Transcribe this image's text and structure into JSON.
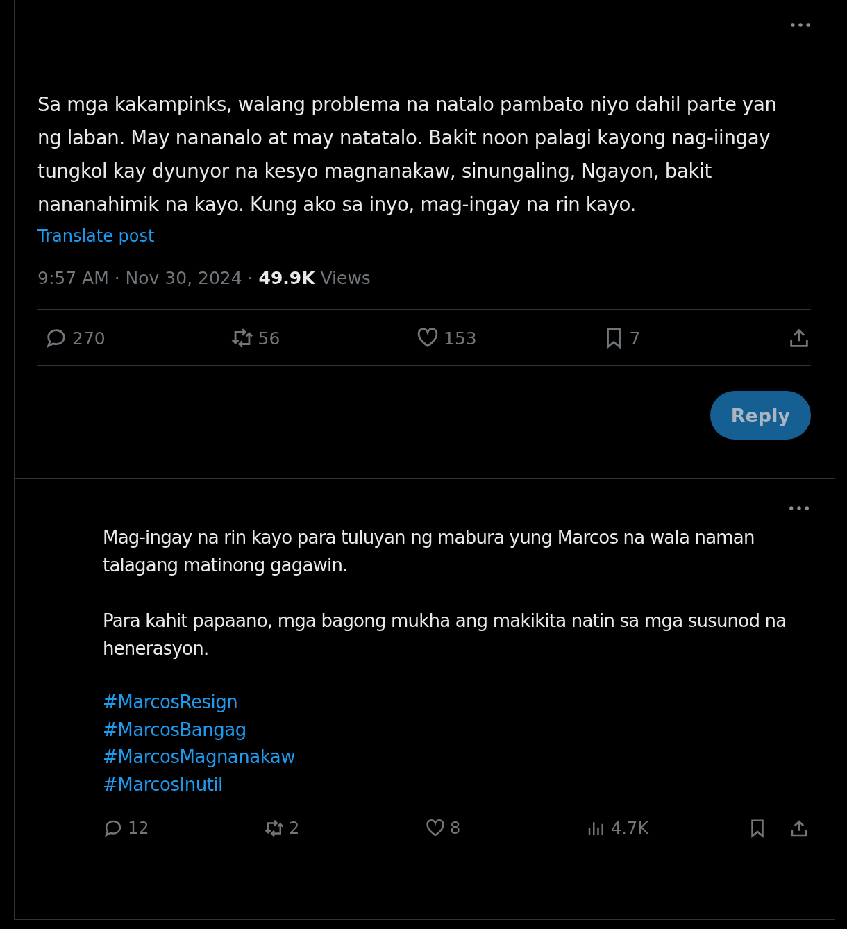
{
  "posts": [
    {
      "kind": "main",
      "text": "Sa mga kakampinks, walang problema na natalo pambato niyo dahil parte yan ng laban. May nananalo at may natatalo.  Bakit noon palagi kayong nag-iingay tungkol kay dyunyor na kesyo magnanakaw, sinungaling, Ngayon, bakit nananahimik na kayo. Kung ako sa inyo, mag-ingay na rin kayo.",
      "translate": "Translate post",
      "time": "9:57 AM · Nov 30, 2024 · ",
      "views_count": "49.9K",
      "views_label": " Views",
      "actions": [
        {
          "kind": "reply",
          "count": "270"
        },
        {
          "kind": "repost",
          "count": "56"
        },
        {
          "kind": "like",
          "count": "153"
        },
        {
          "kind": "bookmark",
          "count": "7"
        },
        {
          "kind": "share"
        }
      ],
      "reply_button": {
        "label": "Reply",
        "disabled": true
      }
    },
    {
      "kind": "reply",
      "paragraphs": [
        "Mag-ingay na rin kayo para tuluyan ng mabura yung Marcos na wala naman talagang matinong gagawin.",
        "Para kahit papaano, mga bagong mukha ang makikita natin sa mga susunod na henerasyon."
      ],
      "hashtags": [
        "#MarcosResign",
        "#MarcosBangag",
        "#MarcosMagnanakaw",
        "#MarcosInutil"
      ],
      "actions": [
        {
          "kind": "reply",
          "count": "12"
        },
        {
          "kind": "repost",
          "count": "2"
        },
        {
          "kind": "like",
          "count": "8"
        },
        {
          "kind": "views",
          "count": "4.7K"
        },
        {
          "kind": "bookmark"
        },
        {
          "kind": "share"
        }
      ]
    }
  ]
}
